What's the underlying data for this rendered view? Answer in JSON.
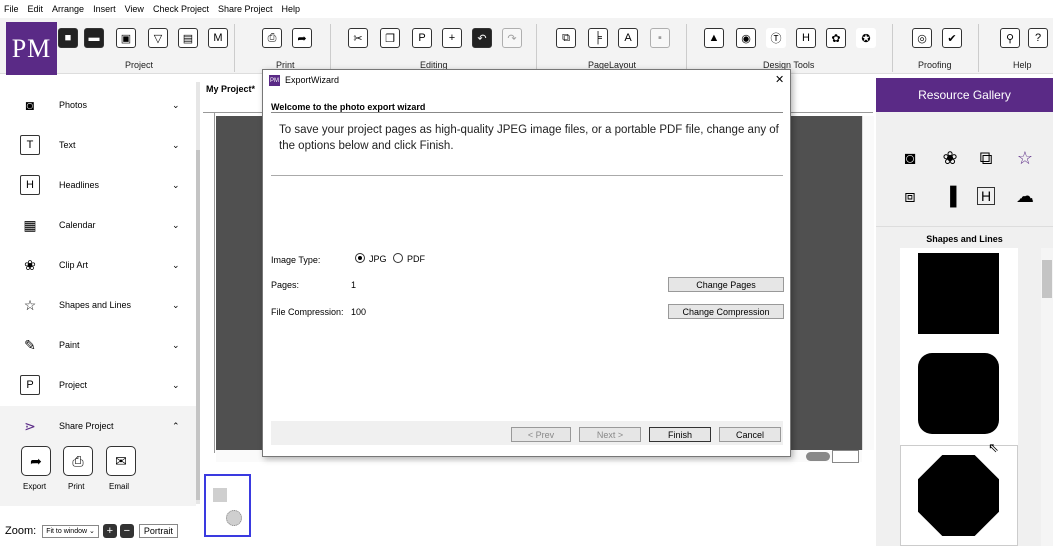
{
  "menu": [
    "File",
    "Edit",
    "Arrange",
    "Insert",
    "View",
    "Check Project",
    "Share Project",
    "Help"
  ],
  "logo_text": "PM",
  "ribbon_groups": {
    "project": "Project",
    "print": "Print",
    "editing": "Editing",
    "pagelayout": "PageLayout",
    "design": "Design Tools",
    "proofing": "Proofing",
    "help": "Help"
  },
  "nav": [
    {
      "label": "Photos"
    },
    {
      "label": "Text"
    },
    {
      "label": "Headlines"
    },
    {
      "label": "Calendar"
    },
    {
      "label": "Clip Art"
    },
    {
      "label": "Shapes and Lines"
    },
    {
      "label": "Paint"
    },
    {
      "label": "Project"
    },
    {
      "label": "Share Project"
    }
  ],
  "share_buttons": {
    "export": "Export",
    "print": "Print",
    "email": "Email"
  },
  "zoom": {
    "label": "Zoom:",
    "value": "Fit to window",
    "orientation": "Portrait"
  },
  "canvas_tab": "My Project*",
  "resource_gallery": {
    "title": "Resource Gallery",
    "section": "Shapes and Lines"
  },
  "dialog": {
    "title": "ExportWizard",
    "heading": "Welcome to the photo export wizard",
    "intro": "To save your project pages as high-quality JPEG image files, or a portable PDF file, change any of the options below and click Finish.",
    "image_type_label": "Image Type:",
    "opt_jpg": "JPG",
    "opt_pdf": "PDF",
    "pages_label": "Pages:",
    "pages_value": "1",
    "compression_label": "File Compression:",
    "compression_value": "100",
    "change_pages": "Change Pages",
    "change_compression": "Change Compression",
    "prev": "< Prev",
    "next": "Next >",
    "finish": "Finish",
    "cancel": "Cancel"
  },
  "colors": {
    "brand": "#5a2a86",
    "canvas": "#505050"
  }
}
